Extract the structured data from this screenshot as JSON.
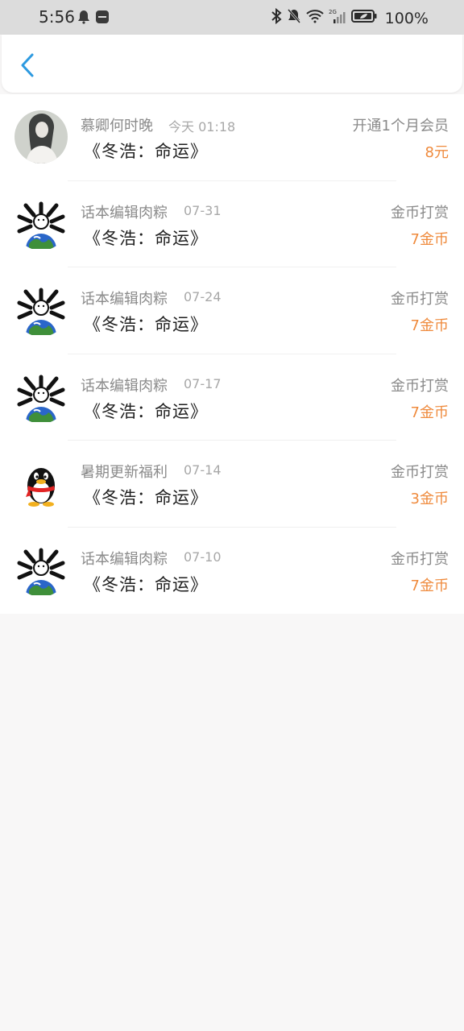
{
  "status_bar": {
    "time": "5:56",
    "battery": "100%",
    "icons": [
      "qq-bell-icon",
      "huawei-app-icon",
      "bluetooth-icon",
      "mute-bell-icon",
      "wifi-icon",
      "signal-2g-icon",
      "battery-icon"
    ]
  },
  "header": {
    "back_icon": "chevron-left-icon",
    "accent": "#2d9ae0"
  },
  "records": [
    {
      "name": "慕卿何时晚",
      "time": "今天 01:18",
      "title": "《冬浩：命运》",
      "type": "开通1个月会员",
      "amount": "8元",
      "avatar": "photo-avatar"
    },
    {
      "name": "话本编辑肉粽",
      "time": "07-31",
      "title": "《冬浩：命运》",
      "type": "金币打赏",
      "amount": "7金币",
      "avatar": "bone-globe-avatar"
    },
    {
      "name": "话本编辑肉粽",
      "time": "07-24",
      "title": "《冬浩：命运》",
      "type": "金币打赏",
      "amount": "7金币",
      "avatar": "bone-globe-avatar"
    },
    {
      "name": "话本编辑肉粽",
      "time": "07-17",
      "title": "《冬浩：命运》",
      "type": "金币打赏",
      "amount": "7金币",
      "avatar": "bone-globe-avatar"
    },
    {
      "name": "暑期更新福利",
      "time": "07-14",
      "title": "《冬浩：命运》",
      "type": "金币打赏",
      "amount": "3金币",
      "avatar": "qq-penguin-avatar"
    },
    {
      "name": "话本编辑肉粽",
      "time": "07-10",
      "title": "《冬浩：命运》",
      "type": "金币打赏",
      "amount": "7金币",
      "avatar": "bone-globe-avatar"
    }
  ],
  "colors": {
    "amount": "#ef8a3c",
    "secondary_text": "#8a8a8a",
    "background": "#f8f7f7"
  }
}
